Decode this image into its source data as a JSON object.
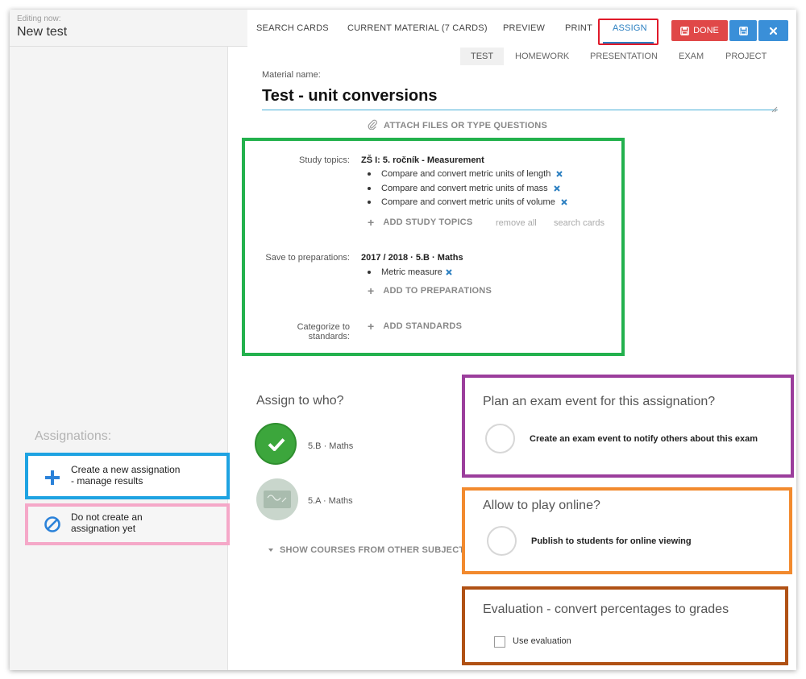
{
  "header": {
    "editing_label": "Editing now:",
    "title": "New test",
    "nav": {
      "search_cards": "SEARCH CARDS",
      "current_material": "CURRENT MATERIAL (7 CARDS)",
      "preview": "PREVIEW",
      "print": "PRINT",
      "assign": "ASSIGN"
    },
    "done_label": "DONE"
  },
  "tabs": {
    "test": "TEST",
    "homework": "HOMEWORK",
    "presentation": "PRESENTATION",
    "exam": "EXAM",
    "project": "PROJECT"
  },
  "material": {
    "label": "Material name:",
    "value": "Test - unit conversions",
    "attach": "ATTACH FILES OR TYPE QUESTIONS"
  },
  "topics": {
    "study_label": "Study topics:",
    "course": "ZŠ I: 5. ročník - Measurement",
    "items": [
      "Compare and convert metric units of length",
      "Compare and convert metric units of mass",
      "Compare and convert metric units of volume"
    ],
    "add_study": "ADD STUDY TOPICS",
    "remove_all": "remove all",
    "search_cards": "search cards",
    "prep_label": "Save to preparations:",
    "prep_course": "2017 / 2018 · 5.B · Maths",
    "prep_items": [
      "Metric measure"
    ],
    "add_prep": "ADD TO PREPARATIONS",
    "standards_label_1": "Categorize to",
    "standards_label_2": "standards:",
    "add_standards": "ADD STANDARDS"
  },
  "left": {
    "assignations": "Assignations:",
    "new_line1": "Create a new assignation",
    "new_line2": "- manage results",
    "none_line1": "Do not create an",
    "none_line2": "assignation yet"
  },
  "assign": {
    "title": "Assign to who?",
    "courses": [
      {
        "name": "5.B · Maths",
        "selected": true
      },
      {
        "name": "5.A · Maths",
        "selected": false
      }
    ],
    "show_courses": "SHOW COURSES FROM OTHER SUBJECTS"
  },
  "options": {
    "exam_title": "Plan an exam event for this assignation?",
    "exam_text": "Create an exam event to notify others about this exam",
    "online_title": "Allow to play online?",
    "online_text": "Publish to students for online viewing",
    "eval_title": "Evaluation - convert percentages to grades",
    "eval_text": "Use evaluation"
  },
  "colors": {
    "accent_blue": "#2b7fc1",
    "done_red": "#e04848",
    "button_blue": "#3a8fd8",
    "selected_green": "#3ca63c"
  }
}
